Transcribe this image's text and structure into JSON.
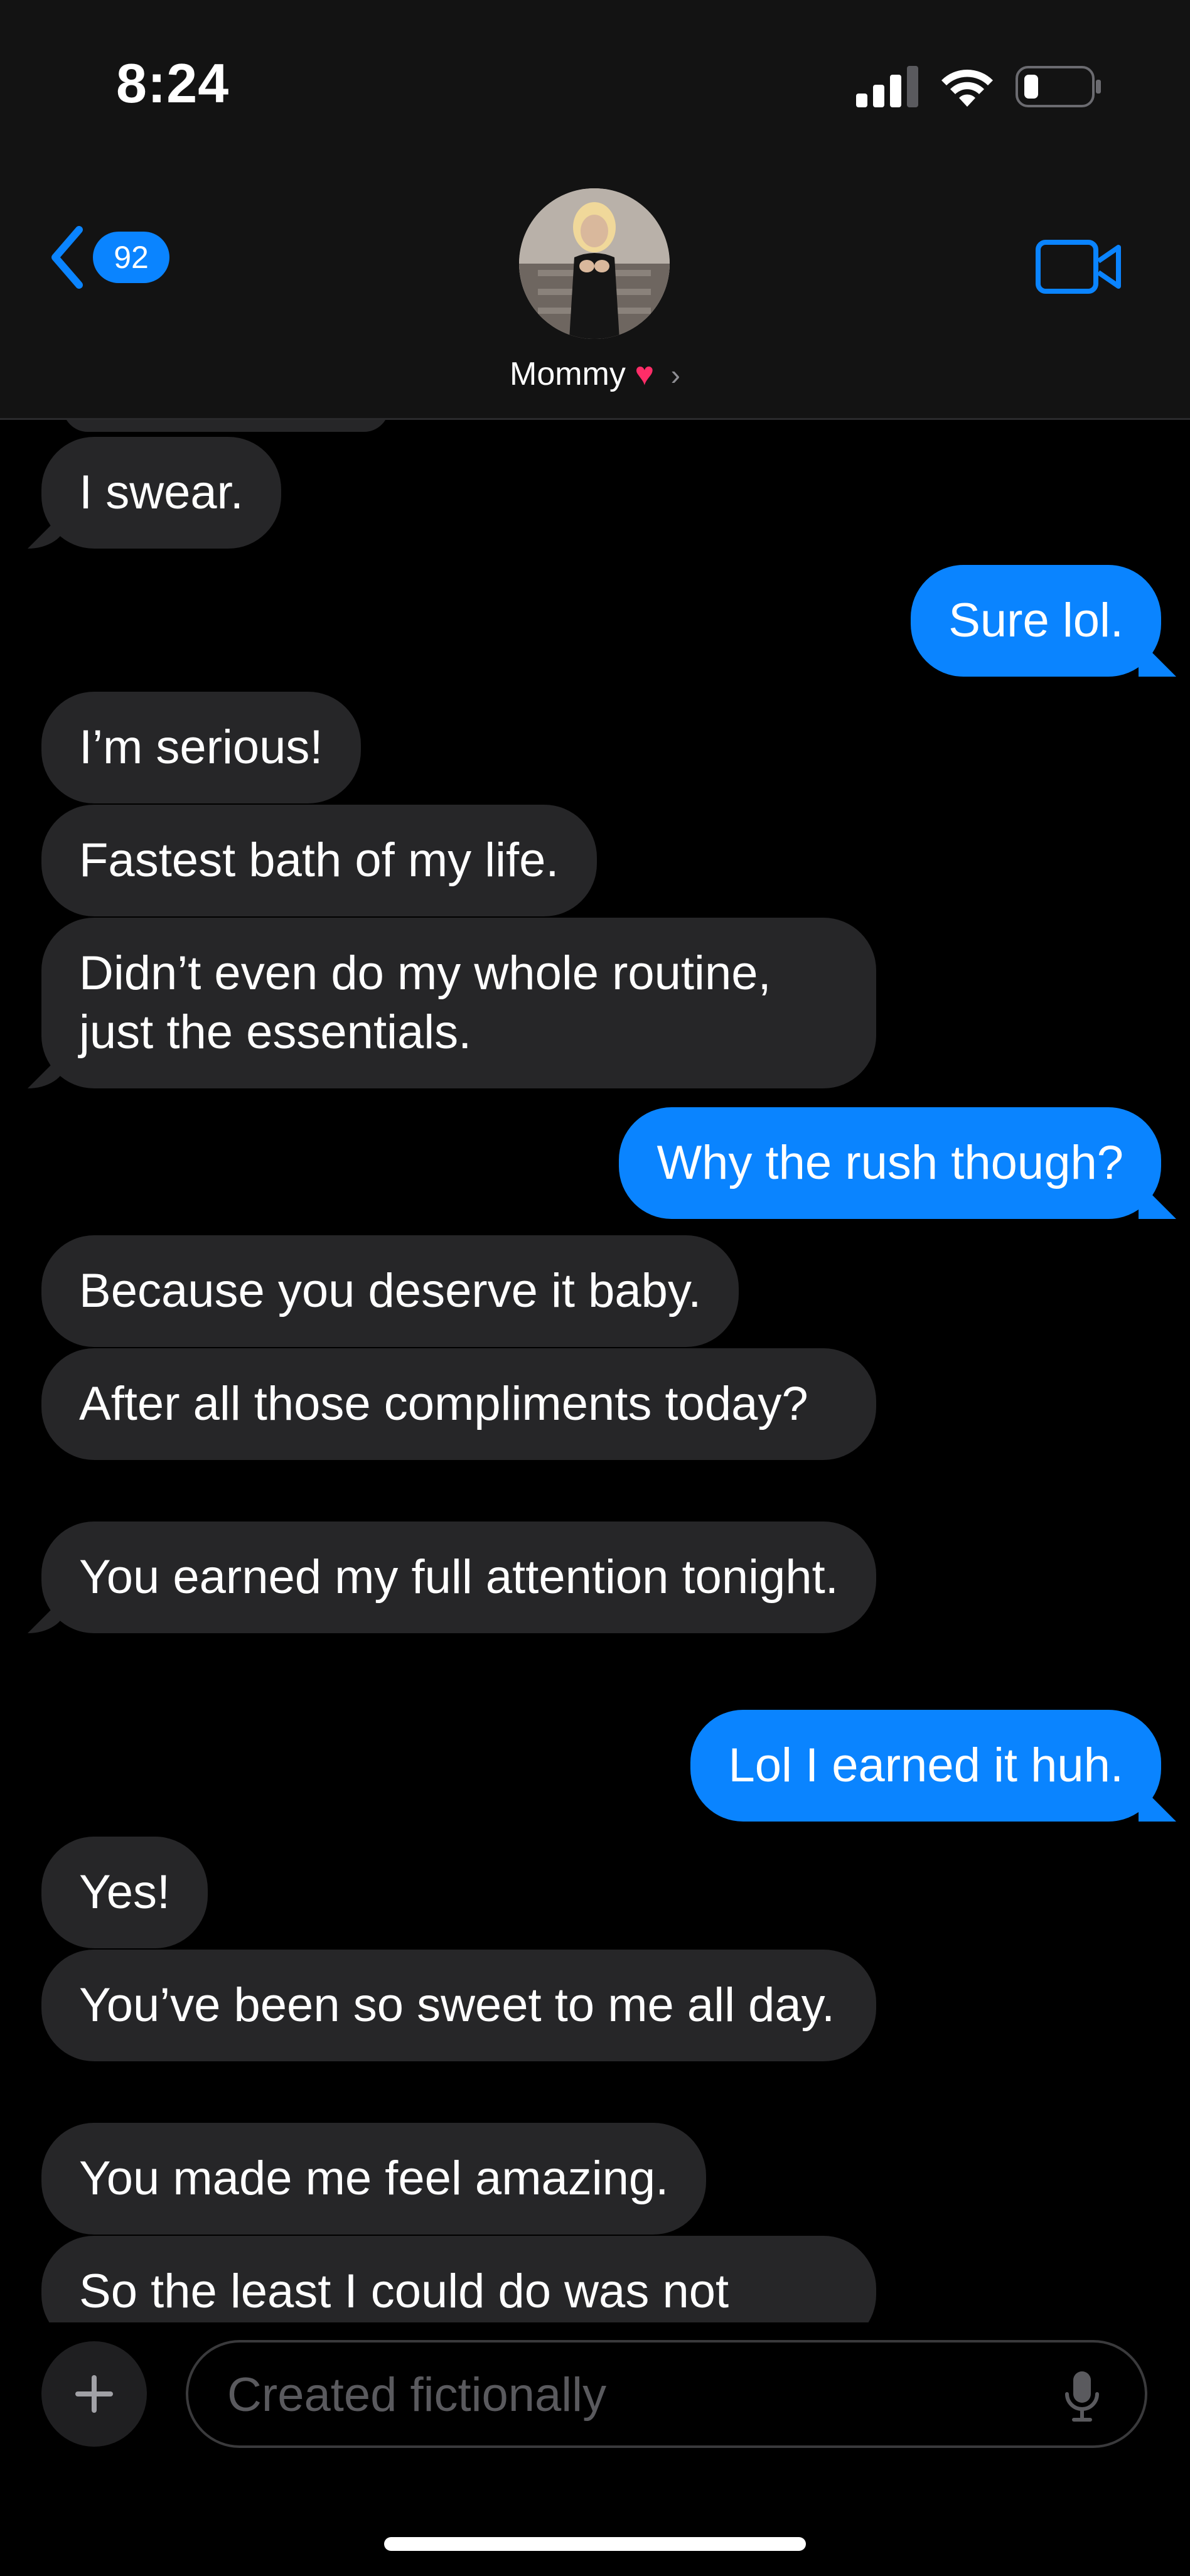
{
  "status_bar": {
    "time": "8:24"
  },
  "header": {
    "back_badge": "92",
    "contact_name": "Mommy",
    "contact_emoji": "♥",
    "chevron": "›",
    "icons": {
      "back": "chevron-left-icon",
      "video": "video-camera-icon"
    },
    "accent_color": "#0a84ff"
  },
  "messages": [
    {
      "from": "them",
      "text": "I swear."
    },
    {
      "from": "me",
      "text": "Sure lol."
    },
    {
      "from": "them",
      "text": "I’m serious!"
    },
    {
      "from": "them",
      "text": "Fastest bath of my life."
    },
    {
      "from": "them",
      "text": "Didn’t even do my whole routine, just the essentials."
    },
    {
      "from": "me",
      "text": "Why the rush though?"
    },
    {
      "from": "them",
      "text": "Because you deserve it baby."
    },
    {
      "from": "them",
      "text": "After all those compliments today?"
    },
    {
      "from": "them",
      "text": "You earned my full attention tonight."
    },
    {
      "from": "me",
      "text": "Lol I earned it huh."
    },
    {
      "from": "them",
      "text": "Yes!"
    },
    {
      "from": "them",
      "text": "You’ve been so sweet to me all day."
    },
    {
      "from": "them",
      "text": "You made me feel amazing."
    },
    {
      "from": "them",
      "text": "So the least I could do was not"
    }
  ],
  "composer": {
    "placeholder": "Created fictionally"
  }
}
